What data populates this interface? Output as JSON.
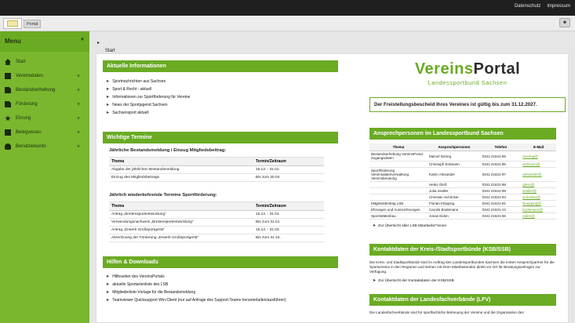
{
  "topbar": {
    "links": [
      "Datenschutz",
      "Impressum"
    ]
  },
  "subbar": {
    "portal_label": "Portal",
    "user_icon": "user-icon"
  },
  "breadcrumb": {
    "label": "Start"
  },
  "sidebar": {
    "title": "Menu",
    "items": [
      {
        "label": "Start",
        "icon": "home-icon",
        "has_arrow": false
      },
      {
        "label": "Vereinsdaten",
        "icon": "grid-icon",
        "has_arrow": true
      },
      {
        "label": "Bestandserhebung",
        "icon": "document-icon",
        "has_arrow": true
      },
      {
        "label": "Förderung",
        "icon": "document-icon",
        "has_arrow": true
      },
      {
        "label": "Ehrung",
        "icon": "star-icon",
        "has_arrow": true
      },
      {
        "label": "Belegwesen",
        "icon": "list-icon",
        "has_arrow": true
      },
      {
        "label": "Benutzerkonto",
        "icon": "users-icon",
        "has_arrow": true
      }
    ]
  },
  "news": {
    "title": "Aktuelle Informationen",
    "items": [
      "Sportnachrichten aus Sachsen",
      "Sport & Recht - aktuell",
      "Informationen zur Sportförderung für Vereine",
      "News der Sportjugend Sachsen",
      "Sachsensport aktuell"
    ]
  },
  "dates": {
    "title": "Wichtige Termine",
    "t1": {
      "subtitle": "Jährliche Bestandsmeldung / Einzug Mitgliedsbeitrag:",
      "headers": [
        "Thema",
        "Termin/Zeitraum"
      ],
      "rows": [
        [
          "Abgabe der jährlichen Bestandsmeldung",
          "15.12. - 31.01."
        ],
        [
          "Einzug des Mitgliedsbeitrags",
          "Bis zum 30.04"
        ]
      ]
    },
    "t2": {
      "subtitle": "Jährlich wiederkehrende Termine Sportförderung:",
      "headers": [
        "Thema",
        "Termin/Zeitraum"
      ],
      "rows": [
        [
          "Antrag „Breitensportentwicklung“",
          "15.12. - 31.01."
        ],
        [
          "Verwendungsnachweis „Breitensportentwicklung“",
          "Bis zum 31.01."
        ],
        [
          "Antrag „Erwerb Großsportgerät“",
          "15.12. - 31.03."
        ],
        [
          "Abrechnung der Förderung „Erwerb Großsportgerät“",
          "Bis zum 31.10."
        ]
      ]
    }
  },
  "help": {
    "title": "Hilfen & Downloads",
    "items": [
      "Hilfeseiten des VereinsPortals",
      "aktuelle Sportartenliste des LSB",
      "Mitgliederliste-Vorlage für die Bestandsmeldung",
      "Teamviewer Quicksupport Win-Client (nur auf Anfrage des Support-Teams herunterladen/ausführen)"
    ]
  },
  "brand": {
    "part1": "Vereins",
    "part2": "Portal",
    "subtitle": "Landessportbund Sachsen"
  },
  "notice": "Der Freistellungsbescheid Ihres Vereines ist gültig bis zum 31.12.2027.",
  "contacts": {
    "title": "Ansprechpersonen im Landessportbund Sachsen",
    "headers": [
      "Thema",
      "Ansprechpersonen",
      "Telefon",
      "E-Mail"
    ],
    "rows": [
      [
        "Bestandserhebung VereinsPortal Zugangsdaten",
        "Marcel Döring",
        "0341 21631-65",
        "doering@"
      ],
      [
        "",
        "Christoph Erdmann",
        "0341 21631-95",
        "erdmann@"
      ],
      [
        "Sportförderung Vereinsdatenverwaltung Vereinsberatung",
        "Katrin Alexander",
        "0341 21631-97",
        "alexander@"
      ],
      [
        "",
        "Heiko Gleß",
        "0341 21631-98",
        "gless@"
      ],
      [
        "",
        "Julia Seidler",
        "0341 21631-99",
        "seidler@"
      ],
      [
        "",
        "Christian Schricker",
        "0341 21631-83",
        "schricker@"
      ],
      [
        "Mitgliedsbeitrag LSB",
        "Florian Klöpping",
        "0341 21631-91",
        "kloepping@"
      ],
      [
        "Ehrungen und Auszeichnungen",
        "Carolin Bodemann",
        "0341 21631-12",
        "bodemann@"
      ],
      [
        "Sportstättenbau",
        "Jonas Eiden",
        "0341 21631-66",
        "eiden@"
      ]
    ],
    "link": "Zur Übersicht aller LSB Mitarbeiter*innen"
  },
  "ksb": {
    "title": "Kontaktdaten der Kreis-/Stadtsportbünde (KSB/SSB)",
    "text": "Die Kreis- und Stadtsportbünde sind im Auftrag des Landessportbundes Sachsen die ersten Ansprechpartner für die Sportvereine in den Regionen und stehen mit ihren Mitarbeitenden direkt vor Ort für Beratungsanfragen zur Verfügung.",
    "link": "Zur Übersicht der Kontaktdaten der KSB/SSB"
  },
  "lfv": {
    "title": "Kontaktdaten der Landesfachverbände (LFV)",
    "text": "Die Landesfachverbände sind für sportfachliche Betreuung der Vereine und die Organisation des"
  }
}
